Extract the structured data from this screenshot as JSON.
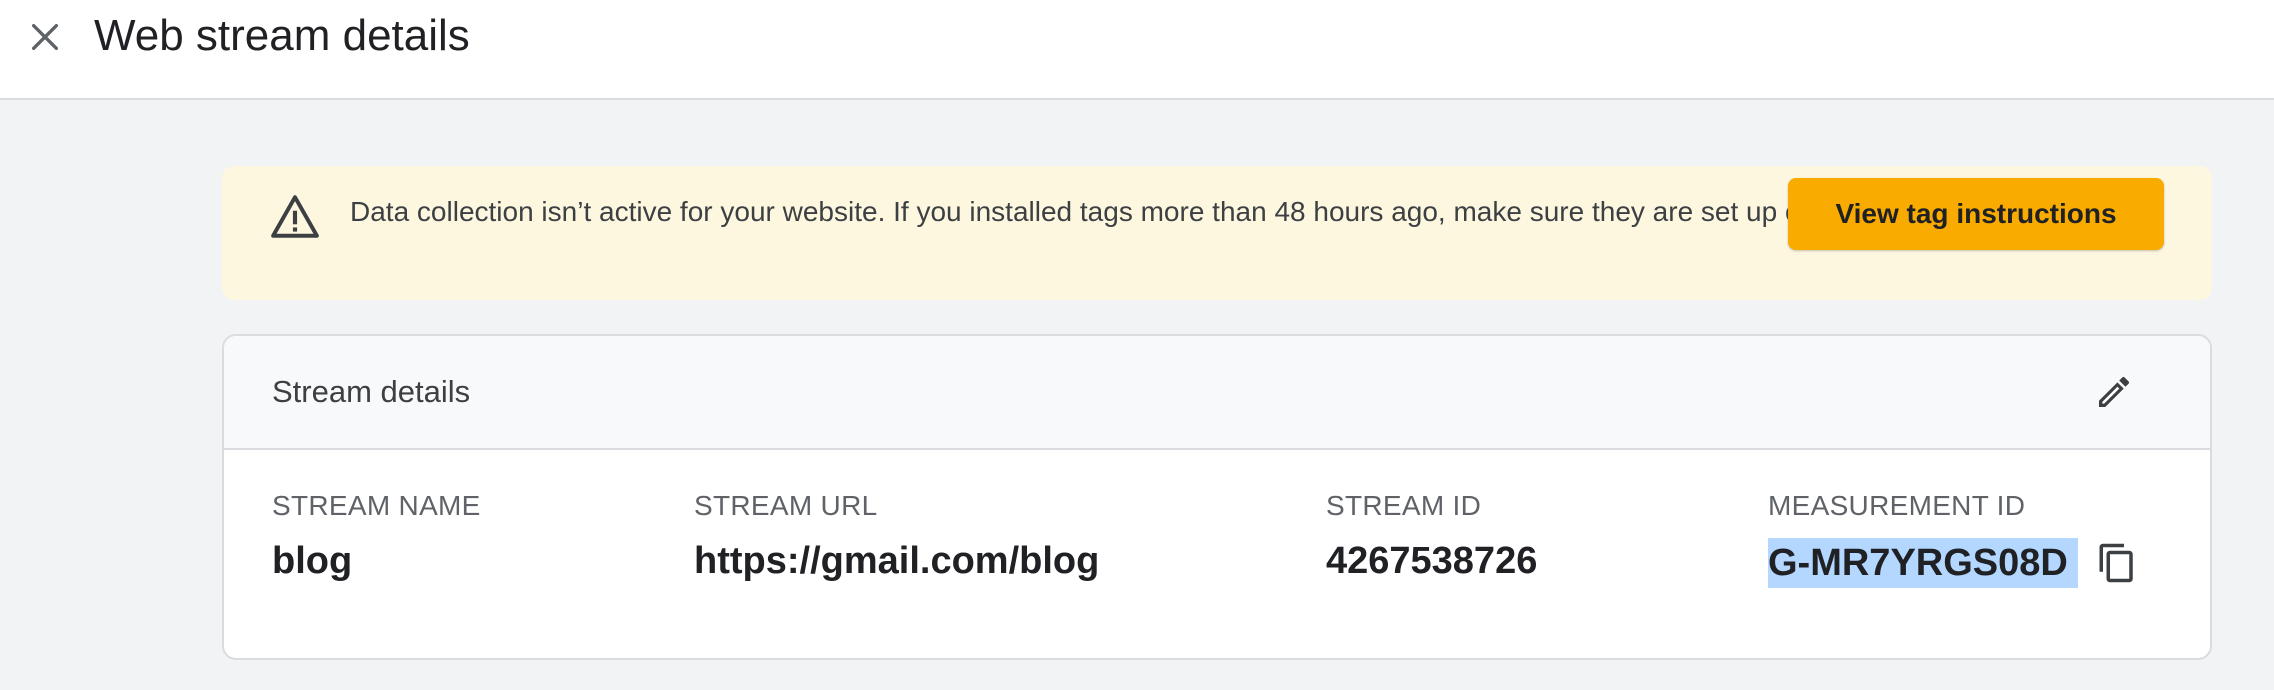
{
  "header": {
    "title": "Web stream details",
    "close_icon": "close-icon"
  },
  "banner": {
    "icon": "warning-icon",
    "message": "Data collection isn’t active for your website. If you installed tags more than 48 hours ago, make sure they are set up correctly.",
    "button_label": "View tag instructions",
    "background_color": "#fef7e0",
    "button_color": "#f9ab00"
  },
  "stream_details": {
    "title": "Stream details",
    "edit_icon": "pencil-icon",
    "fields": {
      "stream_name": {
        "label": "STREAM NAME",
        "value": "blog"
      },
      "stream_url": {
        "label": "STREAM URL",
        "value": "https://gmail.com/blog"
      },
      "stream_id": {
        "label": "STREAM ID",
        "value": "4267538726"
      },
      "measurement_id": {
        "label": "MEASUREMENT ID",
        "value": "G-MR7YRGS08D",
        "copy_icon": "copy-icon",
        "selected": true
      }
    }
  }
}
